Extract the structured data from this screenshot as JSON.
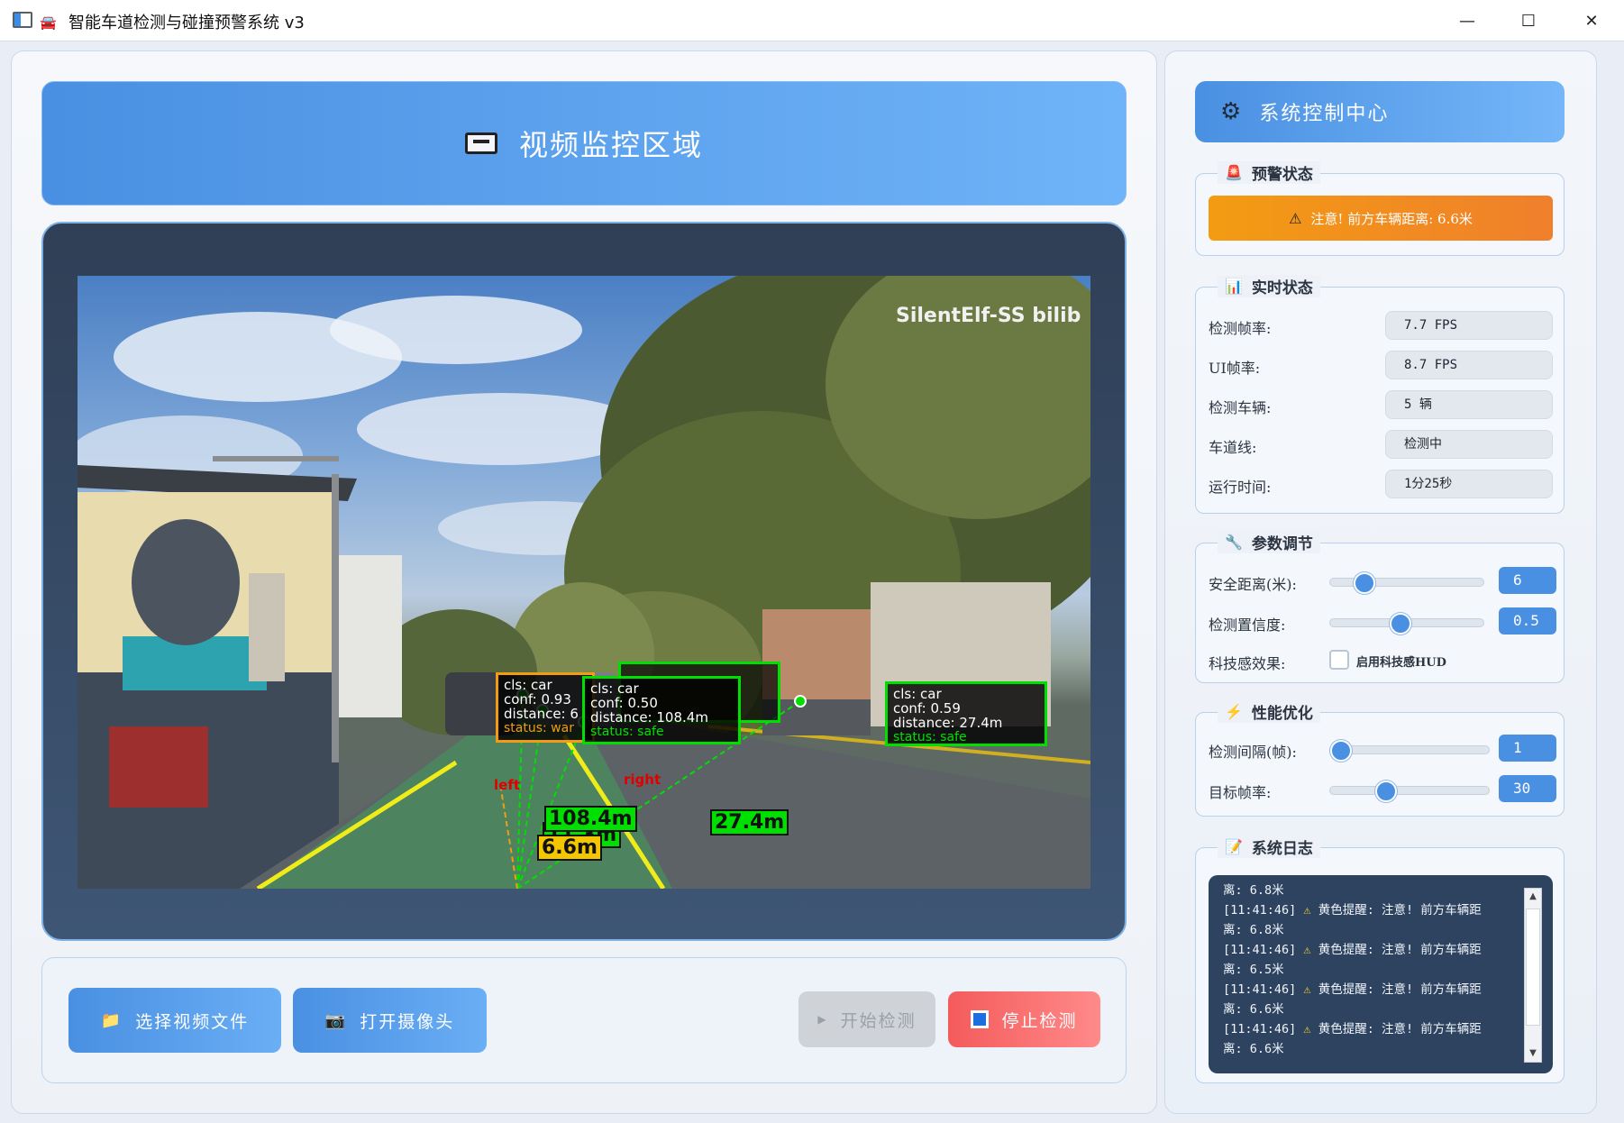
{
  "window": {
    "title": "智能车道检测与碰撞预警系统 v3",
    "minimize": "—",
    "maximize": "☐",
    "close": "✕"
  },
  "video_panel": {
    "header_title": "视频监控区域",
    "watermark": "SilentElf-SS  bilib",
    "lane_left_label": "left",
    "lane_right_label": "right",
    "detections": [
      {
        "cls": "cls: car",
        "conf": "conf: 0.93",
        "distance": "distance: 6",
        "status": "status: war",
        "color": "#f39c12"
      },
      {
        "cls": "cls: car",
        "conf": "conf: 0.50",
        "distance": "distance: 108.4m",
        "status": "status: safe",
        "color": "#00e000"
      },
      {
        "cls": "cls: car",
        "conf": "conf: 0.59",
        "distance": "distance: 27.4m",
        "status": "status: safe",
        "color": "#00e000"
      }
    ],
    "distance_labels": [
      {
        "text": "108.4m",
        "color": "#00e000"
      },
      {
        "text": "6.6m",
        "color": "#f3c600"
      },
      {
        "text": "27.4m",
        "color": "#00e000"
      },
      {
        "text": "11.3m",
        "color": "#00e000"
      }
    ]
  },
  "controls": {
    "select_file": "选择视频文件",
    "open_camera": "打开摄像头",
    "start_detect": "开始检测",
    "stop_detect": "停止检测"
  },
  "system": {
    "header_title": "系统控制中心",
    "alert_group": {
      "title": "预警状态",
      "alert_text": "注意! 前方车辆距离: 6.6米"
    },
    "status_group": {
      "title": "实时状态",
      "rows": [
        {
          "label": "检测帧率:",
          "value": "7.7 FPS"
        },
        {
          "label": "UI帧率:",
          "value": "8.7 FPS"
        },
        {
          "label": "检测车辆:",
          "value": "5 辆"
        },
        {
          "label": "车道线:",
          "value": "检测中"
        },
        {
          "label": "运行时间:",
          "value": "1分25秒"
        }
      ]
    },
    "params_group": {
      "title": "参数调节",
      "safe_distance_label": "安全距离(米):",
      "safe_distance_value": "6",
      "safe_distance_level": 0.18,
      "confidence_label": "检测置信度:",
      "confidence_value": "0.5",
      "confidence_level": 0.45,
      "tech_effect_label": "科技感效果:",
      "hud_checkbox_label": "启用科技感HUD",
      "hud_checked": false
    },
    "perf_group": {
      "title": "性能优化",
      "interval_label": "检测间隔(帧):",
      "interval_value": "1",
      "interval_level": 0.0,
      "fps_label": "目标帧率:",
      "fps_value": "30",
      "fps_level": 0.33
    },
    "log_group": {
      "title": "系统日志",
      "lines": [
        {
          "time": "",
          "text": "离: 6.8米"
        },
        {
          "time": "[11:41:46]",
          "text": "黄色提醒: 注意! 前方车辆距"
        },
        {
          "time": "",
          "text": "离: 6.8米"
        },
        {
          "time": "[11:41:46]",
          "text": "黄色提醒: 注意! 前方车辆距"
        },
        {
          "time": "",
          "text": "离: 6.5米"
        },
        {
          "time": "[11:41:46]",
          "text": "黄色提醒: 注意! 前方车辆距"
        },
        {
          "time": "",
          "text": "离: 6.6米"
        },
        {
          "time": "[11:41:46]",
          "text": "黄色提醒: 注意! 前方车辆距"
        },
        {
          "time": "",
          "text": "离: 6.6米"
        }
      ]
    }
  }
}
